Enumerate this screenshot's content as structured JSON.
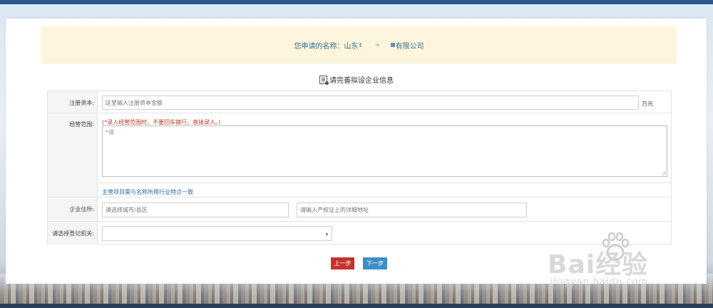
{
  "banner": {
    "prefix": "您申请的名称：山东",
    "suffix": "有限公司"
  },
  "section": {
    "title": "请完善拟设企业信息"
  },
  "form": {
    "capital": {
      "label": "注册资本:",
      "placeholder": "这里输入注册资本金额",
      "unit": "万元"
    },
    "scope": {
      "label": "经营范围:",
      "hint": "(*录入经营范围时，不要回车换行，直接录入。)",
      "value": "*请",
      "note": "主营项目需与名称所用行业特点一致"
    },
    "address": {
      "label": "企业住所:",
      "city_placeholder": "请选择城市/县区",
      "detail_placeholder": "请输入产权证上的详细地址"
    },
    "authority": {
      "label": "请选择登记机关:",
      "value": "",
      "arrow": "▾"
    }
  },
  "buttons": {
    "prev": "上一步",
    "next": "下一步"
  },
  "watermark": {
    "brand": "Bai经验",
    "url": "jingyan.baidu.com"
  },
  "colors": {
    "topbar": "#2a5589",
    "prev": "#c9302c",
    "next": "#3d8ec8",
    "banner_bg": "#fdf5dc"
  }
}
